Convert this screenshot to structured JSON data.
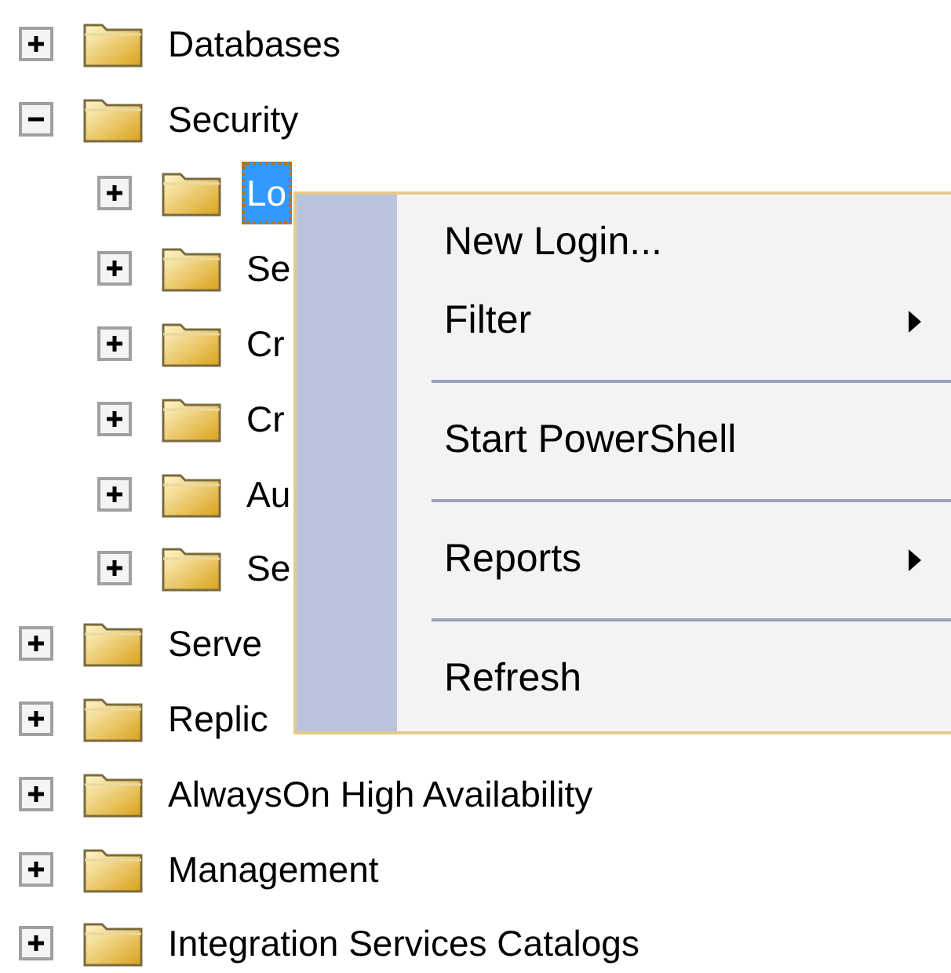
{
  "tree": [
    {
      "label": "Databases",
      "expanded": false,
      "selected": false
    },
    {
      "label": "Security",
      "expanded": true,
      "selected": false,
      "children": [
        {
          "label": "Lo",
          "expanded": false,
          "selected": true
        },
        {
          "label": "Se",
          "expanded": false,
          "selected": false
        },
        {
          "label": "Cr",
          "expanded": false,
          "selected": false
        },
        {
          "label": "Cr",
          "expanded": false,
          "selected": false
        },
        {
          "label": "Au",
          "expanded": false,
          "selected": false
        },
        {
          "label": "Se",
          "expanded": false,
          "selected": false
        }
      ]
    },
    {
      "label": "Serve",
      "expanded": false,
      "selected": false
    },
    {
      "label": "Replic",
      "expanded": false,
      "selected": false
    },
    {
      "label": "AlwaysOn High Availability",
      "expanded": false,
      "selected": false
    },
    {
      "label": "Management",
      "expanded": false,
      "selected": false
    },
    {
      "label": "Integration Services Catalogs",
      "expanded": false,
      "selected": false
    }
  ],
  "context_menu": [
    {
      "kind": "item",
      "label": "New Login...",
      "submenu": false
    },
    {
      "kind": "item",
      "label": "Filter",
      "submenu": true
    },
    {
      "kind": "separator"
    },
    {
      "kind": "item",
      "label": "Start PowerShell",
      "submenu": false
    },
    {
      "kind": "separator"
    },
    {
      "kind": "item",
      "label": "Reports",
      "submenu": true
    },
    {
      "kind": "separator"
    },
    {
      "kind": "item",
      "label": "Refresh",
      "submenu": false
    }
  ]
}
